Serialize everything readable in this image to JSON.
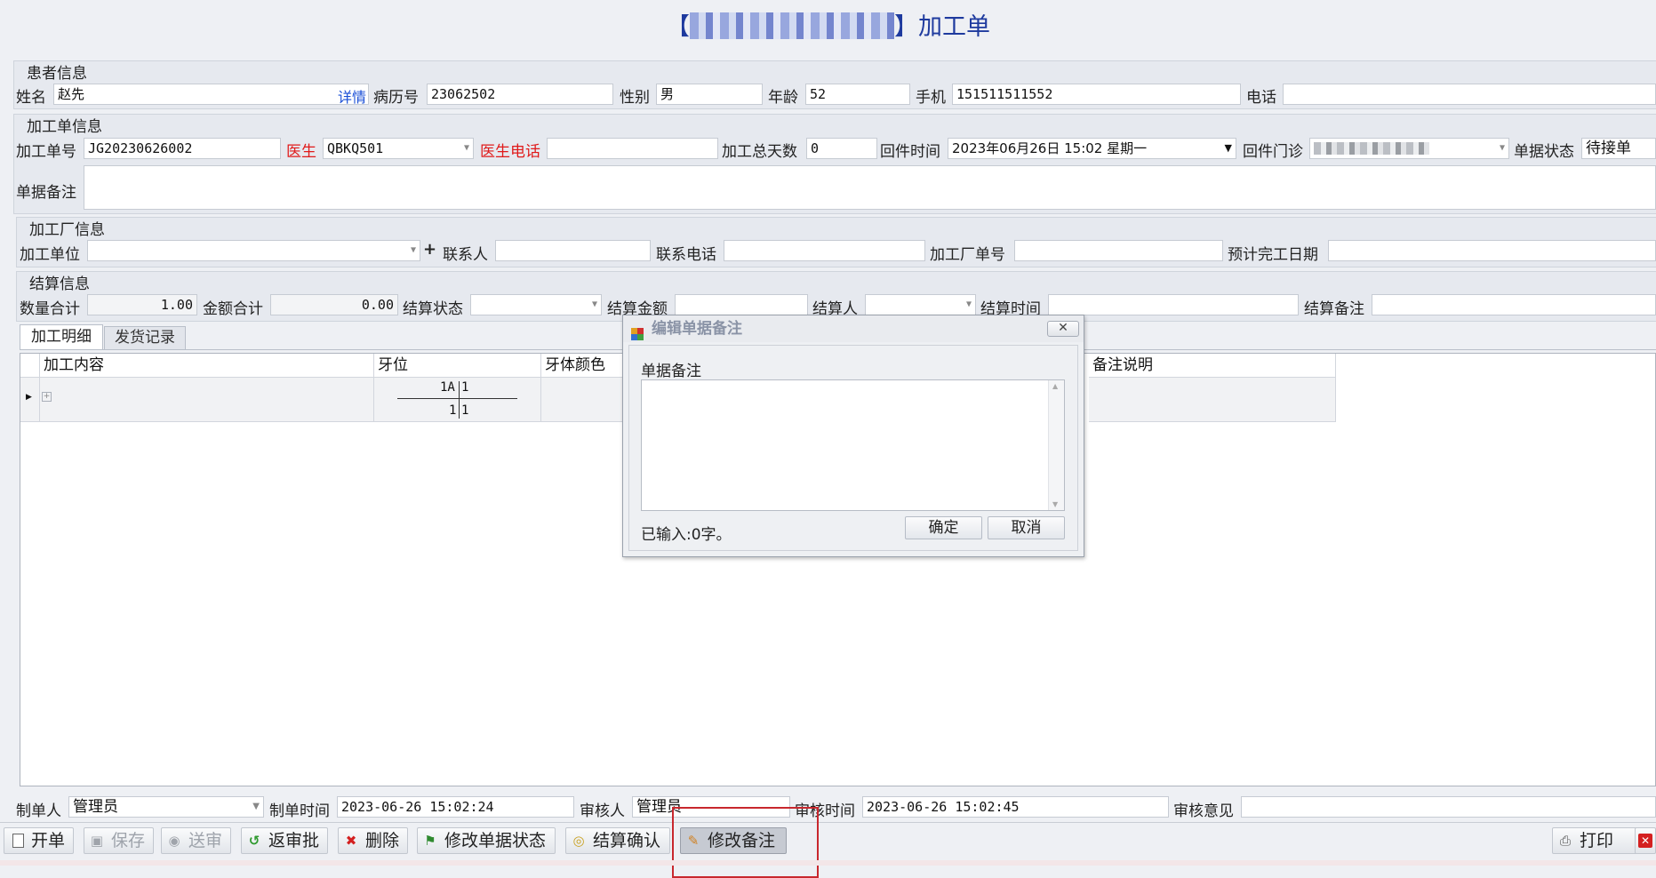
{
  "title": {
    "prefix": "【",
    "suffix": "】加工单"
  },
  "patient": {
    "section_title": "患者信息",
    "name_label": "姓名",
    "name": "赵先",
    "detail_link": "详情",
    "record_label": "病历号",
    "record": "23062502",
    "gender_label": "性别",
    "gender": "男",
    "age_label": "年龄",
    "age": "52",
    "mobile_label": "手机",
    "mobile": "151511511552",
    "phone_label": "电话",
    "phone": ""
  },
  "order": {
    "section_title": "加工单信息",
    "no_label": "加工单号",
    "no": "JG20230626002",
    "doctor_label": "医生",
    "doctor": "QBKQ501",
    "doctor_phone_label": "医生电话",
    "doctor_phone": "",
    "days_label": "加工总天数",
    "days": "0",
    "return_time_label": "回件时间",
    "return_time": "2023年06月26日 15:02 星期一",
    "return_clinic_label": "回件门诊",
    "status_label": "单据状态",
    "status": "待接单",
    "remark_label": "单据备注"
  },
  "factory": {
    "section_title": "加工厂信息",
    "unit_label": "加工单位",
    "unit": "",
    "add_icon": "plus-icon",
    "contact_label": "联系人",
    "contact": "",
    "contact_phone_label": "联系电话",
    "contact_phone": "",
    "factory_no_label": "加工厂单号",
    "factory_no": "",
    "due_date_label": "预计完工日期",
    "due_date": ""
  },
  "settlement": {
    "section_title": "结算信息",
    "qty_label": "数量合计",
    "qty": "1.00",
    "amount_label": "金额合计",
    "amount": "0.00",
    "status_label": "结算状态",
    "status": "",
    "settle_amount_label": "结算金额",
    "settle_amount": "",
    "person_label": "结算人",
    "person": "",
    "time_label": "结算时间",
    "time": "",
    "remark_label": "结算备注",
    "remark": ""
  },
  "tabs": [
    {
      "label": "加工明细",
      "active": true
    },
    {
      "label": "发货记录",
      "active": false
    }
  ],
  "grid": {
    "columns": [
      "加工内容",
      "牙位",
      "牙体颜色",
      "备注说明"
    ],
    "row": {
      "tooth_top": "1A",
      "tooth_top_right": "1",
      "tooth_bottom_left": "1",
      "tooth_bottom_right": "1"
    }
  },
  "dialog": {
    "title": "编辑单据备注",
    "field_label": "单据备注",
    "counter": "已输入:0字。",
    "ok": "确定",
    "cancel": "取消"
  },
  "footer": {
    "creator_label": "制单人",
    "creator": "管理员",
    "create_time_label": "制单时间",
    "create_time": "2023-06-26 15:02:24",
    "auditor_label": "审核人",
    "auditor": "管理员",
    "audit_time_label": "审核时间",
    "audit_time": "2023-06-26 15:02:45",
    "audit_opinion_label": "审核意见",
    "audit_opinion": ""
  },
  "toolbar": {
    "open": "开单",
    "save": "保存",
    "send": "送审",
    "unapprove": "返审批",
    "delete": "删除",
    "modify_status": "修改单据状态",
    "settle_confirm": "结算确认",
    "modify_remark": "修改备注",
    "print": "打印"
  },
  "colors": {
    "title": "#1e3a9e",
    "required_label": "#e01a1a",
    "link": "#1a4fd6",
    "highlight_box": "#c8282e"
  }
}
